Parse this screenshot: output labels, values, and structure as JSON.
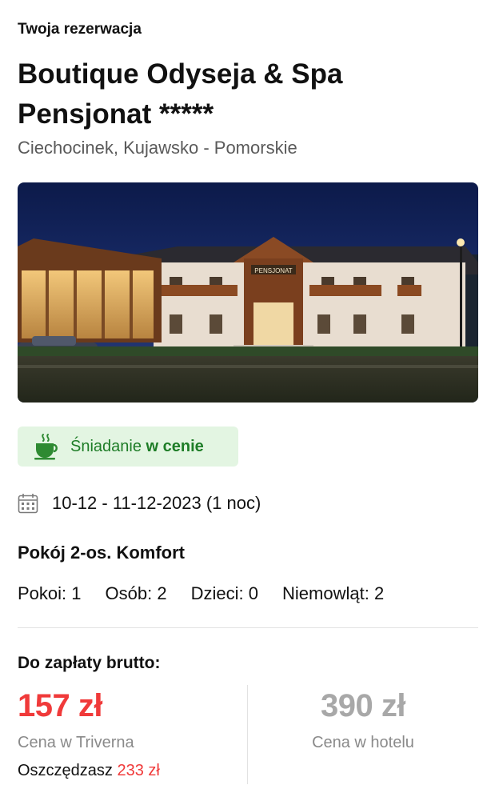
{
  "header": {
    "eyebrow": "Twoja rezerwacja",
    "hotel_name": "Boutique Odyseja & Spa Pensjonat *****",
    "location": "Ciechocinek, Kujawsko - Pomorskie"
  },
  "photo": {
    "sign_text": "PENSJONAT"
  },
  "badge": {
    "icon": "coffee-cup-icon",
    "text_prefix": "Śniadanie ",
    "text_bold": "w cenie",
    "bg_color": "#e3f5e2",
    "text_color": "#1e7d27"
  },
  "stay": {
    "icon": "calendar-icon",
    "dates": "10-12 - 11-12-2023 (1 noc)",
    "room": "Pokój 2-os. Komfort",
    "counts": [
      {
        "label": "Pokoi:",
        "value": "1"
      },
      {
        "label": "Osób:",
        "value": "2"
      },
      {
        "label": "Dzieci:",
        "value": "0"
      },
      {
        "label": "Niemowląt:",
        "value": "2"
      }
    ]
  },
  "payment": {
    "title": "Do zapłaty brutto:",
    "our_price": "157 zł",
    "our_price_label": "Cena w Triverna",
    "savings_label": "Oszczędzasz",
    "savings_amount": "233 zł",
    "hotel_price": "390 zł",
    "hotel_price_label": "Cena w hotelu",
    "accent_color": "#f03a3a"
  }
}
